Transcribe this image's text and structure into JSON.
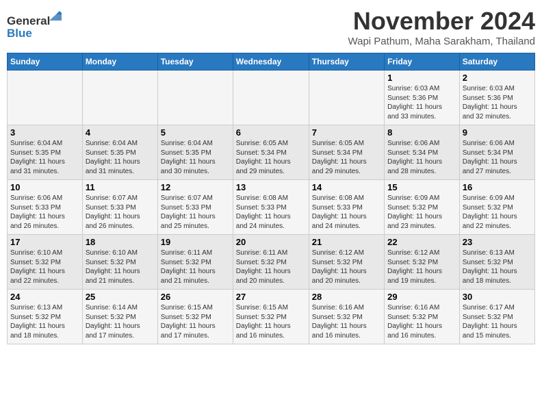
{
  "logo": {
    "line1": "General",
    "line2": "Blue"
  },
  "title": "November 2024",
  "subtitle": "Wapi Pathum, Maha Sarakham, Thailand",
  "weekdays": [
    "Sunday",
    "Monday",
    "Tuesday",
    "Wednesday",
    "Thursday",
    "Friday",
    "Saturday"
  ],
  "weeks": [
    [
      {
        "day": "",
        "info": ""
      },
      {
        "day": "",
        "info": ""
      },
      {
        "day": "",
        "info": ""
      },
      {
        "day": "",
        "info": ""
      },
      {
        "day": "",
        "info": ""
      },
      {
        "day": "1",
        "info": "Sunrise: 6:03 AM\nSunset: 5:36 PM\nDaylight: 11 hours\nand 33 minutes."
      },
      {
        "day": "2",
        "info": "Sunrise: 6:03 AM\nSunset: 5:36 PM\nDaylight: 11 hours\nand 32 minutes."
      }
    ],
    [
      {
        "day": "3",
        "info": "Sunrise: 6:04 AM\nSunset: 5:35 PM\nDaylight: 11 hours\nand 31 minutes."
      },
      {
        "day": "4",
        "info": "Sunrise: 6:04 AM\nSunset: 5:35 PM\nDaylight: 11 hours\nand 31 minutes."
      },
      {
        "day": "5",
        "info": "Sunrise: 6:04 AM\nSunset: 5:35 PM\nDaylight: 11 hours\nand 30 minutes."
      },
      {
        "day": "6",
        "info": "Sunrise: 6:05 AM\nSunset: 5:34 PM\nDaylight: 11 hours\nand 29 minutes."
      },
      {
        "day": "7",
        "info": "Sunrise: 6:05 AM\nSunset: 5:34 PM\nDaylight: 11 hours\nand 29 minutes."
      },
      {
        "day": "8",
        "info": "Sunrise: 6:06 AM\nSunset: 5:34 PM\nDaylight: 11 hours\nand 28 minutes."
      },
      {
        "day": "9",
        "info": "Sunrise: 6:06 AM\nSunset: 5:34 PM\nDaylight: 11 hours\nand 27 minutes."
      }
    ],
    [
      {
        "day": "10",
        "info": "Sunrise: 6:06 AM\nSunset: 5:33 PM\nDaylight: 11 hours\nand 26 minutes."
      },
      {
        "day": "11",
        "info": "Sunrise: 6:07 AM\nSunset: 5:33 PM\nDaylight: 11 hours\nand 26 minutes."
      },
      {
        "day": "12",
        "info": "Sunrise: 6:07 AM\nSunset: 5:33 PM\nDaylight: 11 hours\nand 25 minutes."
      },
      {
        "day": "13",
        "info": "Sunrise: 6:08 AM\nSunset: 5:33 PM\nDaylight: 11 hours\nand 24 minutes."
      },
      {
        "day": "14",
        "info": "Sunrise: 6:08 AM\nSunset: 5:33 PM\nDaylight: 11 hours\nand 24 minutes."
      },
      {
        "day": "15",
        "info": "Sunrise: 6:09 AM\nSunset: 5:32 PM\nDaylight: 11 hours\nand 23 minutes."
      },
      {
        "day": "16",
        "info": "Sunrise: 6:09 AM\nSunset: 5:32 PM\nDaylight: 11 hours\nand 22 minutes."
      }
    ],
    [
      {
        "day": "17",
        "info": "Sunrise: 6:10 AM\nSunset: 5:32 PM\nDaylight: 11 hours\nand 22 minutes."
      },
      {
        "day": "18",
        "info": "Sunrise: 6:10 AM\nSunset: 5:32 PM\nDaylight: 11 hours\nand 21 minutes."
      },
      {
        "day": "19",
        "info": "Sunrise: 6:11 AM\nSunset: 5:32 PM\nDaylight: 11 hours\nand 21 minutes."
      },
      {
        "day": "20",
        "info": "Sunrise: 6:11 AM\nSunset: 5:32 PM\nDaylight: 11 hours\nand 20 minutes."
      },
      {
        "day": "21",
        "info": "Sunrise: 6:12 AM\nSunset: 5:32 PM\nDaylight: 11 hours\nand 20 minutes."
      },
      {
        "day": "22",
        "info": "Sunrise: 6:12 AM\nSunset: 5:32 PM\nDaylight: 11 hours\nand 19 minutes."
      },
      {
        "day": "23",
        "info": "Sunrise: 6:13 AM\nSunset: 5:32 PM\nDaylight: 11 hours\nand 18 minutes."
      }
    ],
    [
      {
        "day": "24",
        "info": "Sunrise: 6:13 AM\nSunset: 5:32 PM\nDaylight: 11 hours\nand 18 minutes."
      },
      {
        "day": "25",
        "info": "Sunrise: 6:14 AM\nSunset: 5:32 PM\nDaylight: 11 hours\nand 17 minutes."
      },
      {
        "day": "26",
        "info": "Sunrise: 6:15 AM\nSunset: 5:32 PM\nDaylight: 11 hours\nand 17 minutes."
      },
      {
        "day": "27",
        "info": "Sunrise: 6:15 AM\nSunset: 5:32 PM\nDaylight: 11 hours\nand 16 minutes."
      },
      {
        "day": "28",
        "info": "Sunrise: 6:16 AM\nSunset: 5:32 PM\nDaylight: 11 hours\nand 16 minutes."
      },
      {
        "day": "29",
        "info": "Sunrise: 6:16 AM\nSunset: 5:32 PM\nDaylight: 11 hours\nand 16 minutes."
      },
      {
        "day": "30",
        "info": "Sunrise: 6:17 AM\nSunset: 5:32 PM\nDaylight: 11 hours\nand 15 minutes."
      }
    ]
  ]
}
